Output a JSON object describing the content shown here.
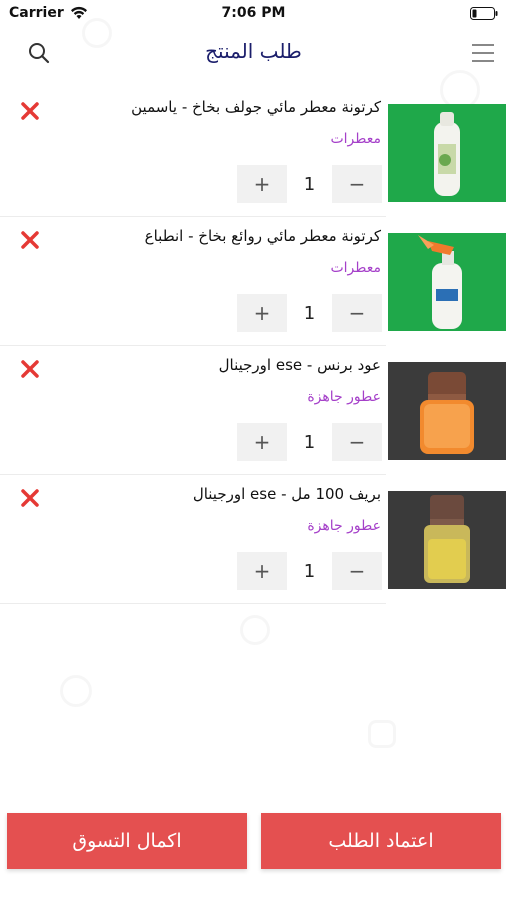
{
  "status_bar": {
    "carrier": "Carrier",
    "time": "7:06 PM"
  },
  "header": {
    "title": "طلب المنتج"
  },
  "cart": {
    "items": [
      {
        "name": "كرتونة معطر مائي جولف بخاخ - ياسمين",
        "category": "معطرات",
        "quantity": "1",
        "image": "green-spray-bottle"
      },
      {
        "name": "كرتونة معطر مائي روائع بخاخ - انطباع",
        "category": "معطرات",
        "quantity": "1",
        "image": "green-spray-bottle-orange-trigger"
      },
      {
        "name": "عود برنس - ese اورجينال",
        "category": "عطور جاهزة",
        "quantity": "1",
        "image": "orange-perfume-bottle"
      },
      {
        "name": "بريف 100 مل - ese اورجينال",
        "category": "عطور جاهزة",
        "quantity": "1",
        "image": "yellow-perfume-bottle"
      }
    ],
    "plus_label": "+",
    "minus_label": "−"
  },
  "actions": {
    "continue_label": "اكمال التسوق",
    "confirm_label": "اعتماد الطلب"
  },
  "colors": {
    "title": "#1b1e6b",
    "category": "#a540c9",
    "remove": "#e53935",
    "button": "#e45050"
  }
}
